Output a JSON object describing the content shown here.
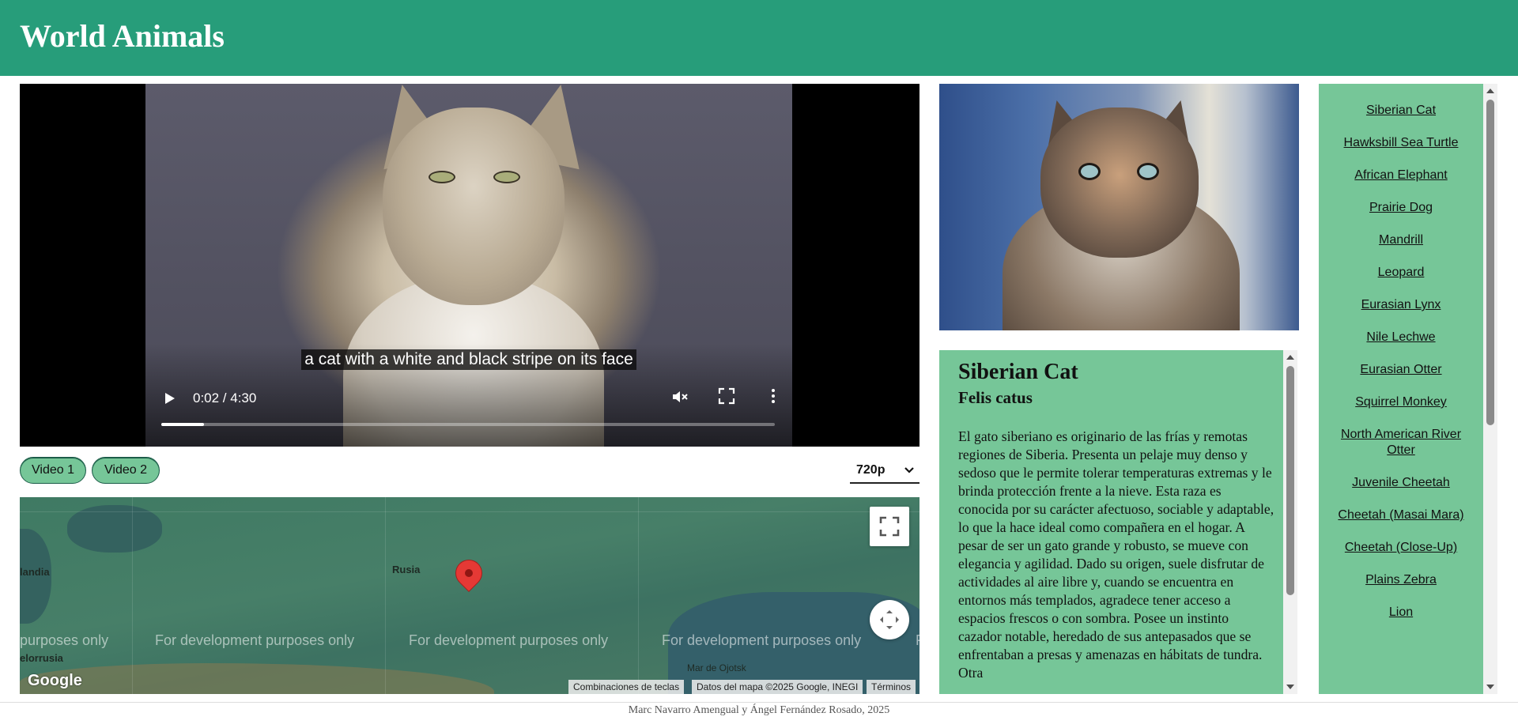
{
  "header": {
    "title": "World Animals"
  },
  "video": {
    "caption": "a cat with a white and black stripe on its face",
    "time_display": "0:02 / 4:30",
    "progress": 0.07,
    "muted": true,
    "icons": {
      "play": "play-icon",
      "mute": "muted-speaker-icon",
      "fullscreen": "fullscreen-icon",
      "more": "more-vertical-icon"
    }
  },
  "video_buttons": [
    {
      "label": "Video 1"
    },
    {
      "label": "Video 2"
    }
  ],
  "quality_select": {
    "value": "720p"
  },
  "map": {
    "places": [
      "Rusia",
      "landia",
      "elorrusia",
      "Mar de Ojotsk"
    ],
    "watermark": "For development purposes only",
    "watermark_partial_left": "purposes only",
    "watermark_partial_right": "F",
    "logo": "Google",
    "attribution": {
      "shortcuts": "Combinaciones de teclas",
      "data": "Datos del mapa ©2025 Google, INEGI",
      "terms": "Términos"
    }
  },
  "animal": {
    "name": "Siberian Cat",
    "scientific_name": "Felis catus",
    "description": "El gato siberiano es originario de las frías y remotas regiones de Siberia. Presenta un pelaje muy denso y sedoso que le permite tolerar temperaturas extremas y le brinda protección frente a la nieve. Esta raza es conocida por su carácter afectuoso, sociable y adaptable, lo que la hace ideal como compañera en el hogar. A pesar de ser un gato grande y robusto, se mueve con elegancia y agilidad. Dado su origen, suele disfrutar de actividades al aire libre y, cuando se encuentra en entornos más templados, agradece tener acceso a espacios frescos o con sombra. Posee un instinto cazador notable, heredado de sus antepasados que se enfrentaban a presas y amenazas en hábitats de tundra. Otra"
  },
  "animal_list": [
    "Siberian Cat",
    "Hawksbill Sea Turtle",
    "African Elephant",
    "Prairie Dog",
    "Mandrill",
    "Leopard",
    "Eurasian Lynx",
    "Nile Lechwe",
    "Eurasian Otter",
    "Squirrel Monkey",
    "North American River Otter",
    "Juvenile Cheetah",
    "Cheetah (Masai Mara)",
    "Cheetah (Close-Up)",
    "Plains Zebra",
    "Lion"
  ],
  "footer": {
    "text": "Marc Navarro Amengual y Ángel Fernández Rosado, 2025"
  },
  "colors": {
    "header": "#279d7a",
    "panel": "#76c698",
    "pin": "#e53935"
  }
}
